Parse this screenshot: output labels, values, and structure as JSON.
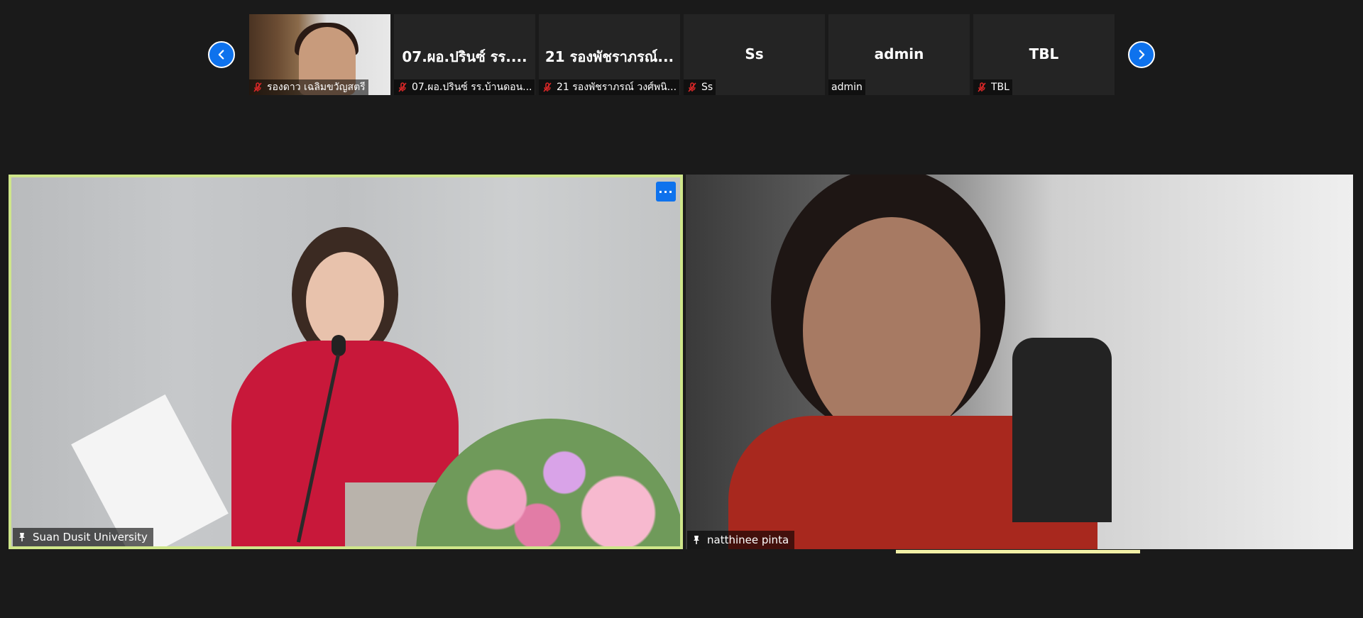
{
  "gallery": {
    "prev_icon": "chevron-left-icon",
    "next_icon": "chevron-right-icon",
    "thumbnails": [
      {
        "big_name": "",
        "label": "รองดาว เฉลิมขวัญสตรี",
        "muted": true,
        "has_video": true
      },
      {
        "big_name": "07.ผอ.ปรินซ์ รร....",
        "label": "07.ผอ.ปรินซ์ รร.บ้านดอน...",
        "muted": true,
        "has_video": false
      },
      {
        "big_name": "21 รองพัชราภรณ์...",
        "label": "21 รองพัชราภรณ์ วงศ์พนิ...",
        "muted": true,
        "has_video": false
      },
      {
        "big_name": "Ss",
        "label": "Ss",
        "muted": true,
        "has_video": false
      },
      {
        "big_name": "admin",
        "label": "admin",
        "muted": false,
        "has_video": false
      },
      {
        "big_name": "TBL",
        "label": "TBL",
        "muted": true,
        "has_video": false
      }
    ]
  },
  "main": {
    "left_tile": {
      "name": "Suan Dusit University",
      "more_label": "···",
      "pinned": true,
      "active_speaker": true
    },
    "right_tile": {
      "name": "natthinee pinta",
      "pinned": true
    }
  },
  "colors": {
    "background": "#1a1a1a",
    "thumb_bg": "#242424",
    "accent_blue": "#0e72ed",
    "speaker_border": "#cfe68a",
    "mute_red": "#e02828"
  }
}
